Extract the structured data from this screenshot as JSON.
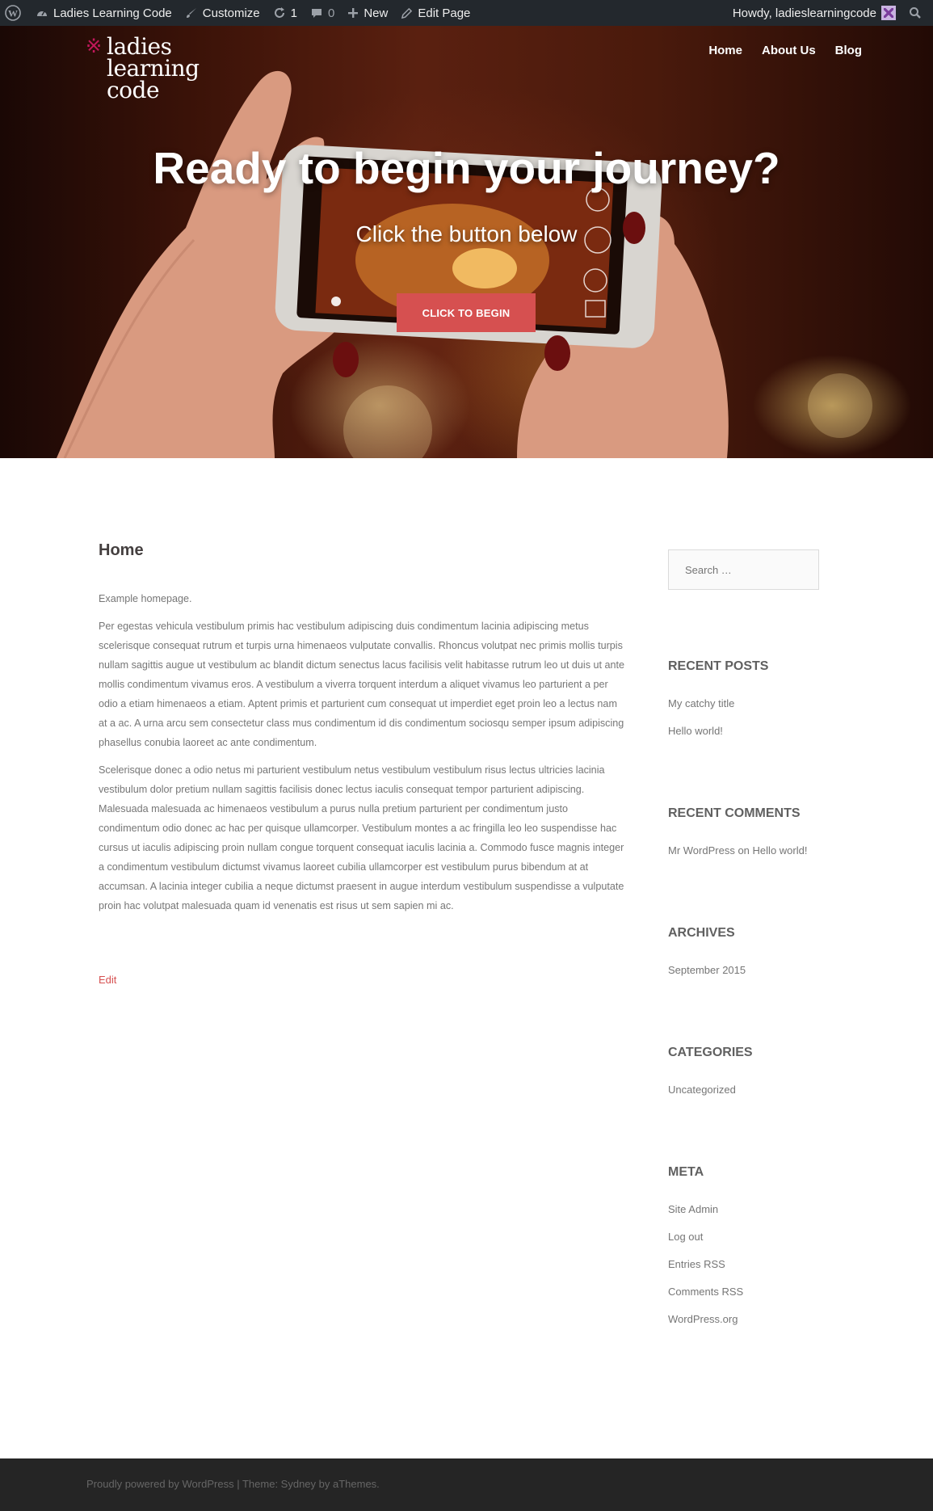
{
  "adminbar": {
    "site_name": "Ladies Learning Code",
    "customize": "Customize",
    "updates_count": "1",
    "comments_count": "0",
    "new_label": "New",
    "edit_page": "Edit Page",
    "howdy": "Howdy, ladieslearningcode"
  },
  "logo": {
    "line1": "ladies",
    "line2": "learning",
    "line3": "code",
    "mark": "※"
  },
  "nav": [
    "Home",
    "About Us",
    "Blog"
  ],
  "hero": {
    "title": "Ready to begin your journey?",
    "subtitle": "Click the button below",
    "button": "CLICK TO BEGIN"
  },
  "main": {
    "title": "Home",
    "intro": "Example homepage.",
    "para1": "Per egestas vehicula vestibulum primis hac vestibulum adipiscing duis condimentum lacinia adipiscing metus scelerisque consequat rutrum et turpis urna himenaeos vulputate convallis. Rhoncus volutpat nec primis mollis turpis nullam sagittis augue ut vestibulum ac blandit dictum senectus lacus facilisis velit habitasse rutrum leo ut duis ut ante mollis condimentum vivamus eros. A vestibulum a viverra torquent interdum a aliquet vivamus leo parturient a per odio a etiam himenaeos a etiam. Aptent primis et parturient cum consequat ut imperdiet eget proin leo a lectus nam at a ac. A urna arcu sem consectetur class mus condimentum id dis condimentum sociosqu semper ipsum adipiscing phasellus conubia laoreet ac ante condimentum.",
    "para2": "Scelerisque donec a odio netus mi parturient vestibulum netus vestibulum vestibulum risus lectus ultricies lacinia vestibulum dolor pretium nullam sagittis facilisis donec lectus iaculis consequat tempor parturient adipiscing. Malesuada malesuada ac himenaeos vestibulum a purus nulla pretium parturient per condimentum justo condimentum odio donec ac hac per quisque ullamcorper. Vestibulum montes a ac fringilla leo leo suspendisse hac cursus ut iaculis adipiscing proin nullam congue torquent consequat iaculis lacinia a. Commodo fusce magnis integer a condimentum vestibulum dictumst vivamus laoreet cubilia ullamcorper est vestibulum purus bibendum at at accumsan. A lacinia integer cubilia a neque dictumst praesent in augue interdum vestibulum suspendisse a vulputate proin hac volutpat malesuada quam id venenatis est risus ut sem sapien mi ac.",
    "edit": "Edit"
  },
  "sidebar": {
    "search_placeholder": "Search …",
    "recent_posts": {
      "title": "RECENT POSTS",
      "items": [
        "My catchy title",
        "Hello world!"
      ]
    },
    "recent_comments": {
      "title": "RECENT COMMENTS",
      "author": "Mr WordPress",
      "on": "on",
      "post": "Hello world!"
    },
    "archives": {
      "title": "ARCHIVES",
      "items": [
        "September 2015"
      ]
    },
    "categories": {
      "title": "CATEGORIES",
      "items": [
        "Uncategorized"
      ]
    },
    "meta": {
      "title": "META",
      "items": [
        "Site Admin",
        "Log out",
        "Entries RSS",
        "Comments RSS",
        "WordPress.org"
      ]
    }
  },
  "footer": {
    "powered": "Proudly powered by WordPress",
    "sep": "|",
    "theme": "Theme: Sydney by aThemes."
  },
  "colors": {
    "accent": "#d65050",
    "adminbar": "#23282d",
    "footer": "#252525"
  }
}
